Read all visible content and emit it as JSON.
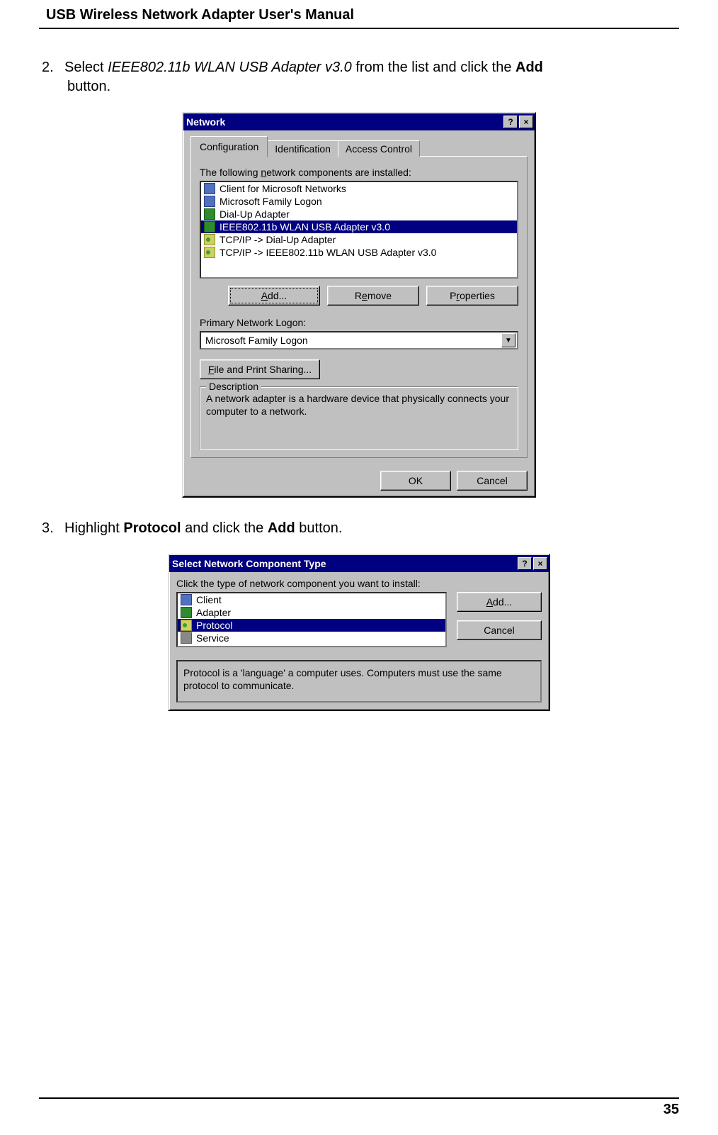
{
  "header": {
    "title": "USB Wireless Network Adapter User's Manual"
  },
  "step2": {
    "num": "2.",
    "pre": "Select ",
    "italic": "IEEE802.11b WLAN USB Adapter v3.0",
    "mid": " from the list and click the ",
    "bold": "Add",
    "post": " button."
  },
  "step3": {
    "num": "3.",
    "pre": "Highlight ",
    "bold1": "Protocol",
    "mid": " and click the ",
    "bold2": "Add",
    "post": " button."
  },
  "dialog1": {
    "title": "Network",
    "tabs": [
      "Configuration",
      "Identification",
      "Access Control"
    ],
    "components_label_pre": "The following ",
    "components_label_ul": "n",
    "components_label_post": "etwork components are installed:",
    "items": [
      {
        "iconClass": "icon-client",
        "label": "Client for Microsoft Networks"
      },
      {
        "iconClass": "icon-client",
        "label": "Microsoft Family Logon"
      },
      {
        "iconClass": "icon-adapter",
        "label": "Dial-Up Adapter"
      },
      {
        "iconClass": "icon-adapter",
        "label": "IEEE802.11b WLAN USB Adapter v3.0",
        "selected": true
      },
      {
        "iconClass": "icon-protocol",
        "label": "TCP/IP -> Dial-Up Adapter"
      },
      {
        "iconClass": "icon-protocol",
        "label": "TCP/IP -> IEEE802.11b WLAN USB Adapter v3.0"
      }
    ],
    "buttons": {
      "add": "Add...",
      "remove": "Remove",
      "properties": "Properties"
    },
    "primary_label": "Primary Network Logon:",
    "primary_value": "Microsoft Family Logon",
    "file_print": "File and Print Sharing...",
    "desc_title": "Description",
    "desc_text": "A network adapter is a hardware device that physically connects your computer to a network.",
    "ok": "OK",
    "cancel": "Cancel",
    "help_btn": "?",
    "close_btn": "×"
  },
  "dialog2": {
    "title": "Select Network Component Type",
    "prompt": "Click the type of network component you want to install:",
    "items": [
      {
        "iconClass": "icon-client",
        "label": "Client"
      },
      {
        "iconClass": "icon-adapter",
        "label": "Adapter"
      },
      {
        "iconClass": "icon-protocol",
        "label": "Protocol",
        "selected": true
      },
      {
        "iconClass": "icon-service",
        "label": "Service"
      }
    ],
    "add": "Add...",
    "cancel": "Cancel",
    "info": "Protocol is a 'language' a computer uses. Computers must use the same protocol to communicate.",
    "help_btn": "?",
    "close_btn": "×"
  },
  "footer": {
    "page": "35"
  }
}
